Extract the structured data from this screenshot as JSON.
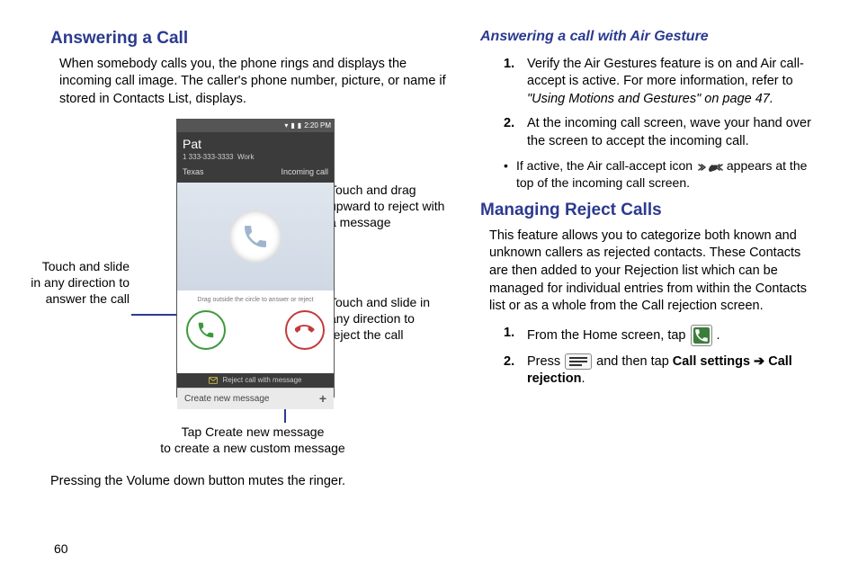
{
  "left": {
    "h1": "Answering a Call",
    "intro": "When somebody calls you, the phone rings and displays the incoming call image. The caller's phone number, picture, or name if stored in Contacts List, displays.",
    "mute": "Pressing the Volume down button mutes the ringer.",
    "figure": {
      "status_time": "2:20 PM",
      "caller_name": "Pat",
      "caller_number": "1 333-333-3333",
      "caller_label": "Work",
      "caller_loc": "Texas",
      "incoming": "Incoming call",
      "drag_hint": "Drag outside the circle to answer or reject",
      "reject_bar": "Reject call with message",
      "create_msg": "Create new message",
      "callouts": {
        "answer": "Touch and slide in any direction to answer the call",
        "reject_msg": "Touch and drag upward to reject with a message",
        "reject": "Touch and slide in any direction to reject the call",
        "newmsg": "Tap Create new message\nto create a new custom message"
      }
    }
  },
  "right": {
    "h2": "Answering a call with Air Gesture",
    "steps_air": [
      {
        "n": "1.",
        "body_a": "Verify the Air Gestures feature is on and Air call-accept is active. For more information, refer to ",
        "it": "\"Using Motions and Gestures\"",
        "body_b": "  on page 47."
      },
      {
        "n": "2.",
        "body_a": "At the incoming call screen, wave your hand over the screen to accept the incoming call."
      }
    ],
    "bullet_air_a": "If active, the Air call-accept icon ",
    "bullet_air_b": " appears at the top of the incoming call screen.",
    "h1b": "Managing Reject Calls",
    "manage_intro": "This feature allows you to categorize both known and unknown callers as rejected contacts. These Contacts are then added to your Rejection list which can be managed for individual entries from within the Contacts list or as a whole from the Call rejection screen.",
    "steps_mr": [
      {
        "n": "1.",
        "a": "From the Home screen, tap ",
        "b": "."
      },
      {
        "n": "2.",
        "a": "Press ",
        "b": " and then tap ",
        "c": "Call settings",
        "d": "Call rejection",
        "e": "."
      }
    ]
  },
  "pagenum": "60"
}
